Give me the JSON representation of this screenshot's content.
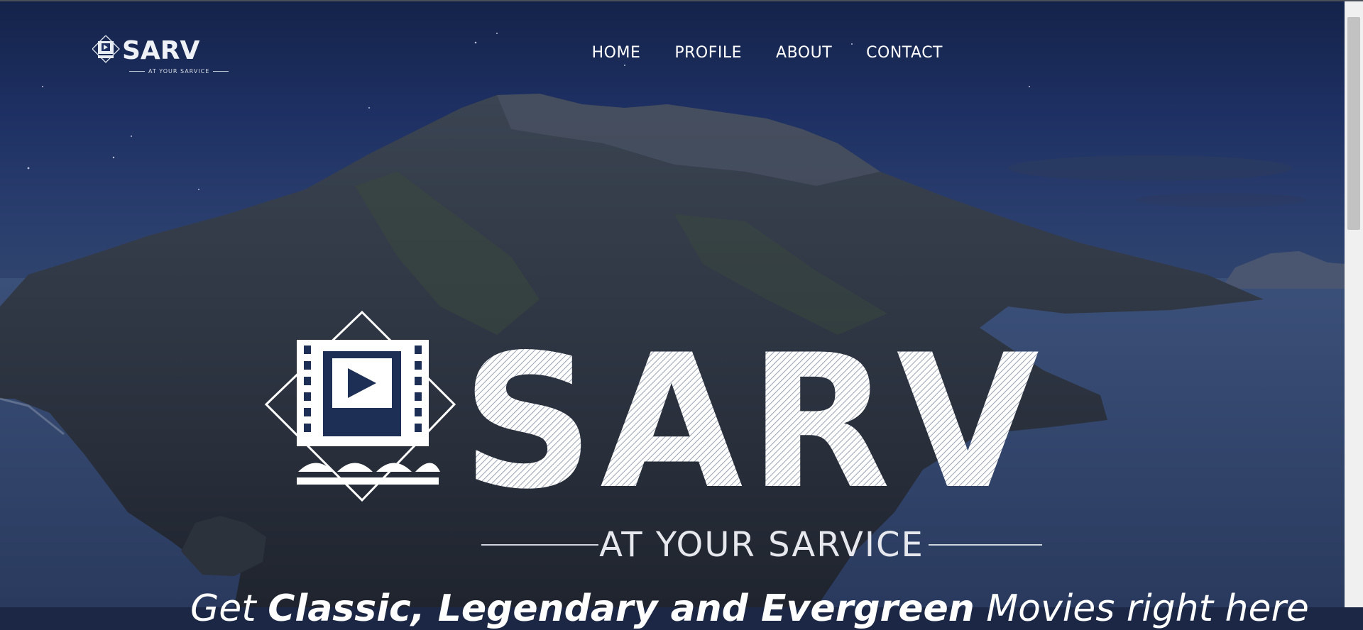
{
  "brand": {
    "logo_text": "SARV",
    "tagline": "AT YOUR SARVICE",
    "hero_logo_text": "SARV",
    "hero_tagline": "AT YOUR SARVICE"
  },
  "nav": {
    "items": [
      {
        "label": "HOME"
      },
      {
        "label": "PROFILE"
      },
      {
        "label": "ABOUT"
      },
      {
        "label": "CONTACT"
      }
    ]
  },
  "hero": {
    "headline_parts": [
      "Get ",
      "Classic, Legendary and Evergreen",
      " Movies right here"
    ]
  },
  "colors": {
    "sky_top": "#142349",
    "sea": "#33476f",
    "text": "#ffffff"
  },
  "icons": {
    "logo_icon": "film-play-icon",
    "diamond": "diamond-outline-icon"
  }
}
